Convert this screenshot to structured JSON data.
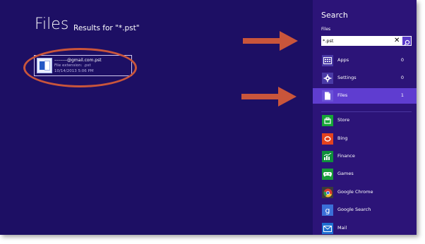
{
  "main": {
    "title": "Files",
    "results_label": "Results for \"*.pst\"",
    "result": {
      "file_name": "––––––@gmail.com.pst",
      "extension_line": "File extension: .pst",
      "date_line": "10/14/2013 5:06 PM"
    }
  },
  "charm": {
    "title": "Search",
    "scope": "Files",
    "search_value": "*.pst",
    "clear_icon": "clear-x-icon",
    "go_icon": "magnifier-icon",
    "categories": [
      {
        "label": "Apps",
        "count": "0",
        "icon": "apps-icon"
      },
      {
        "label": "Settings",
        "count": "0",
        "icon": "gear-icon"
      },
      {
        "label": "Files",
        "count": "1",
        "icon": "document-icon"
      }
    ],
    "apps": [
      {
        "label": "Store",
        "icon": "store-icon",
        "color": "#16a637"
      },
      {
        "label": "Bing",
        "icon": "bing-icon",
        "color": "#e3421e"
      },
      {
        "label": "Finance",
        "icon": "finance-icon",
        "color": "#0f8f3c"
      },
      {
        "label": "Games",
        "icon": "games-icon",
        "color": "#1a9b3a"
      },
      {
        "label": "Google Chrome",
        "icon": "chrome-icon",
        "color": "#3b3b3b"
      },
      {
        "label": "Google Search",
        "icon": "google-search-icon",
        "color": "#3b6fd8"
      },
      {
        "label": "Mail",
        "icon": "mail-icon",
        "color": "#1e6fd0"
      }
    ]
  },
  "colors": {
    "background": "#1d0f64",
    "charm_background": "#2c1478",
    "selected": "#5f3dd0",
    "annotation": "#c9553b"
  }
}
